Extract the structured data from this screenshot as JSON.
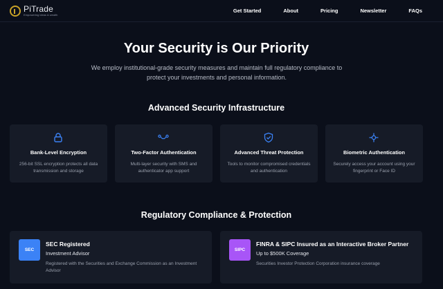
{
  "brand": {
    "name": "PiTrade",
    "tagline": "Empowering ideas & wealth"
  },
  "nav": {
    "items": [
      {
        "label": "Get Started"
      },
      {
        "label": "About"
      },
      {
        "label": "Pricing"
      },
      {
        "label": "Newsletter"
      },
      {
        "label": "FAQs"
      }
    ]
  },
  "hero": {
    "title": "Your Security is Our Priority",
    "subtitle": "We employ institutional-grade security measures and maintain full regulatory compliance to protect your investments and personal information."
  },
  "infrastructure": {
    "title": "Advanced Security Infrastructure",
    "cards": [
      {
        "icon": "lock-icon",
        "title": "Bank-Level Encryption",
        "desc": "256-bit SSL encryption protects all data transmission and storage"
      },
      {
        "icon": "connection-icon",
        "title": "Two-Factor Authentication",
        "desc": "Multi-layer security with SMS and authenticator app support"
      },
      {
        "icon": "shield-check-icon",
        "title": "Advanced Threat Protection",
        "desc": "Tools to monitor compromised credentials and authentication"
      },
      {
        "icon": "crosshair-icon",
        "title": "Biometric Authentication",
        "desc": "Securely access your account using your fingerprint or Face ID"
      }
    ]
  },
  "compliance": {
    "title": "Regulatory Compliance & Protection",
    "cards": [
      {
        "badge": "SEC",
        "badge_color": "#3b82f6",
        "title": "SEC Registered",
        "subtitle": "Investment Advisor",
        "desc": "Registered with the Securities and Exchange Commission as an Investment Advisor"
      },
      {
        "badge": "SIPC",
        "badge_color": "#a855f7",
        "title": "FINRA & SIPC Insured as an Interactive Broker Partner",
        "subtitle": "Up to $500K Coverage",
        "desc": "Securities Investor Protection Corporation insurance coverage"
      }
    ]
  },
  "colors": {
    "accent": "#3b82f6",
    "brand_gold": "#c9a227",
    "background": "#0b0f1a",
    "card": "#161b27"
  }
}
